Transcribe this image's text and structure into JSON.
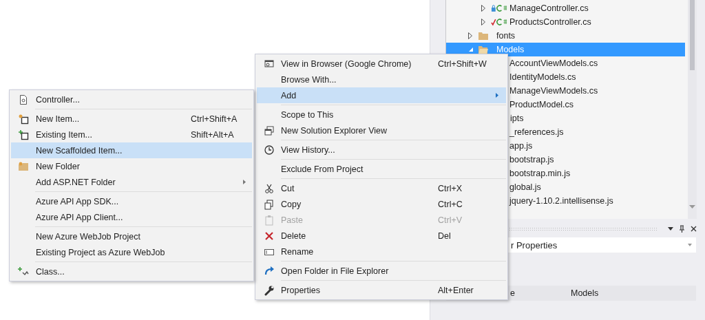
{
  "solution_explorer": {
    "items": [
      {
        "children": [
          {
            "label": "ManageController.cs",
            "kind": "locked",
            "expanded": false,
            "selected": false
          },
          {
            "label": "ProductsController.cs",
            "kind": "checked",
            "expanded": false,
            "selected": false
          }
        ]
      },
      {
        "label": "fonts",
        "kind": "folder",
        "expanded": false,
        "selected": false
      },
      {
        "label": "Models",
        "kind": "folder",
        "expanded": true,
        "selected": true,
        "children": [
          {
            "label": "AccountViewModels.cs",
            "selected": false
          },
          {
            "label": "IdentityModels.cs",
            "selected": false
          },
          {
            "label": "ManageViewModels.cs",
            "selected": false
          },
          {
            "label": "ProductModel.cs",
            "selected": false
          }
        ]
      },
      {
        "label": "ipts",
        "clipped": true,
        "selected": false,
        "children": [
          {
            "label": "_references.js",
            "selected": false
          },
          {
            "label": "app.js",
            "selected": false
          },
          {
            "label": "bootstrap.js",
            "selected": false
          },
          {
            "label": "bootstrap.min.js",
            "selected": false
          },
          {
            "label": "global.js",
            "selected": false
          },
          {
            "label": "jquery-1.10.2.intellisense.js",
            "selected": false
          }
        ]
      }
    ]
  },
  "properties": {
    "object_field": {
      "value": "r Properties"
    },
    "rows": [
      {
        "name": "e",
        "value": "Models"
      }
    ]
  },
  "context_menu": {
    "items": [
      {
        "kind": "item",
        "label": "View in Browser (Google Chrome)",
        "shortcut": "Ctrl+Shift+W",
        "selected": false,
        "disabled": false
      },
      {
        "kind": "item",
        "label": "Browse With...",
        "selected": false,
        "disabled": false
      },
      {
        "kind": "item",
        "label": "Add",
        "submenu": true,
        "selected": true,
        "disabled": false
      },
      {
        "kind": "separator"
      },
      {
        "kind": "item",
        "label": "Scope to This",
        "selected": false,
        "disabled": false
      },
      {
        "kind": "item",
        "label": "New Solution Explorer View",
        "selected": false,
        "disabled": false
      },
      {
        "kind": "separator"
      },
      {
        "kind": "item",
        "label": "View History...",
        "selected": false,
        "disabled": false
      },
      {
        "kind": "separator"
      },
      {
        "kind": "item",
        "label": "Exclude From Project",
        "selected": false,
        "disabled": false
      },
      {
        "kind": "separator"
      },
      {
        "kind": "item",
        "label": "Cut",
        "shortcut": "Ctrl+X",
        "selected": false,
        "disabled": false
      },
      {
        "kind": "item",
        "label": "Copy",
        "shortcut": "Ctrl+C",
        "selected": false,
        "disabled": false
      },
      {
        "kind": "item",
        "label": "Paste",
        "shortcut": "Ctrl+V",
        "selected": false,
        "disabled": true
      },
      {
        "kind": "item",
        "label": "Delete",
        "shortcut": "Del",
        "selected": false,
        "disabled": false
      },
      {
        "kind": "item",
        "label": "Rename",
        "selected": false,
        "disabled": false
      },
      {
        "kind": "separator"
      },
      {
        "kind": "item",
        "label": "Open Folder in File Explorer",
        "selected": false,
        "disabled": false
      },
      {
        "kind": "separator"
      },
      {
        "kind": "item",
        "label": "Properties",
        "shortcut": "Alt+Enter",
        "selected": false,
        "disabled": false
      }
    ]
  },
  "add_submenu": {
    "items": [
      {
        "kind": "item",
        "label": "Controller...",
        "selected": false,
        "disabled": false
      },
      {
        "kind": "separator"
      },
      {
        "kind": "item",
        "label": "New Item...",
        "shortcut": "Ctrl+Shift+A",
        "selected": false,
        "disabled": false
      },
      {
        "kind": "item",
        "label": "Existing Item...",
        "shortcut": "Shift+Alt+A",
        "selected": false,
        "disabled": false
      },
      {
        "kind": "item",
        "label": "New Scaffolded Item...",
        "selected": true,
        "disabled": false
      },
      {
        "kind": "item",
        "label": "New Folder",
        "selected": false,
        "disabled": false
      },
      {
        "kind": "item",
        "label": "Add ASP.NET Folder",
        "submenu": true,
        "selected": false,
        "disabled": false
      },
      {
        "kind": "separator"
      },
      {
        "kind": "item",
        "label": "Azure API App SDK...",
        "selected": false,
        "disabled": false
      },
      {
        "kind": "item",
        "label": "Azure API App Client...",
        "selected": false,
        "disabled": false
      },
      {
        "kind": "separator"
      },
      {
        "kind": "item",
        "label": "New Azure WebJob Project",
        "selected": false,
        "disabled": false
      },
      {
        "kind": "item",
        "label": "Existing Project as Azure WebJob",
        "selected": false,
        "disabled": false
      },
      {
        "kind": "separator"
      },
      {
        "kind": "item",
        "label": "Class...",
        "selected": false,
        "disabled": false
      }
    ]
  }
}
